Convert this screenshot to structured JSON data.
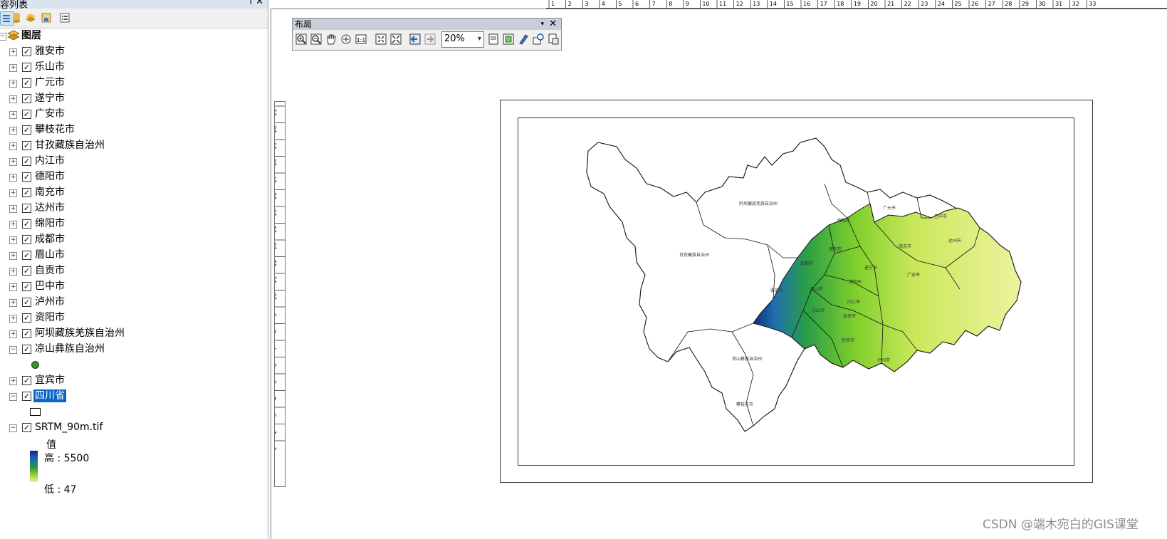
{
  "toc": {
    "title": "容列表",
    "root_label": "图层",
    "layers": [
      {
        "label": "雅安市"
      },
      {
        "label": "乐山市"
      },
      {
        "label": "广元市"
      },
      {
        "label": "遂宁市"
      },
      {
        "label": "广安市"
      },
      {
        "label": "攀枝花市"
      },
      {
        "label": "甘孜藏族自治州"
      },
      {
        "label": "内江市"
      },
      {
        "label": "德阳市"
      },
      {
        "label": "南充市"
      },
      {
        "label": "达州市"
      },
      {
        "label": "绵阳市"
      },
      {
        "label": "成都市"
      },
      {
        "label": "眉山市"
      },
      {
        "label": "自贡市"
      },
      {
        "label": "巴中市"
      },
      {
        "label": "泸州市"
      },
      {
        "label": "资阳市"
      },
      {
        "label": "阿坝藏族羌族自治州"
      },
      {
        "label": "凉山彝族自治州"
      },
      {
        "label": "宜宾市"
      },
      {
        "label": "四川省"
      },
      {
        "label": "SRTM_90m.tif"
      }
    ],
    "legend_value_label": "值",
    "legend_high": "高 : 5500",
    "legend_low": "低 : 47",
    "pin": "ꟾ",
    "close": "✕"
  },
  "layout_toolbar": {
    "title": "布局",
    "zoom_value": "20%",
    "dropdown_glyph": "▾",
    "close": "✕"
  },
  "ruler": {
    "h_ticks": [
      "1",
      "2",
      "3",
      "4",
      "5",
      "6",
      "7",
      "8",
      "9",
      "10",
      "11",
      "12",
      "13",
      "14",
      "15",
      "16",
      "17",
      "18",
      "19",
      "20",
      "21",
      "22",
      "23",
      "24",
      "25",
      "26",
      "27",
      "28",
      "29",
      "30",
      "31",
      "32",
      "33"
    ],
    "v_ticks": [
      "21",
      "20",
      "19",
      "18",
      "17",
      "16",
      "15",
      "14",
      "13",
      "12",
      "11",
      "10",
      "9",
      "8",
      "7",
      "6",
      "5",
      "4",
      "3",
      "2",
      "1"
    ]
  },
  "map_labels": {
    "aba": "阿坝藏族羌族自治州",
    "ganzi": "甘孜藏族自治州",
    "liangshan": "凉山彝族自治州",
    "panzhihua": "攀枝花市",
    "guangyuan": "广元市",
    "bazhong": "巴中市",
    "mianyang": "绵阳市",
    "dazhou": "达州市",
    "nanchong": "南充市",
    "deyang": "德阳市",
    "chengdu": "成都市",
    "suining": "遂宁市",
    "guangan": "广安市",
    "ziyang": "资阳市",
    "yaan": "雅安市",
    "meishan": "眉山市",
    "neijiang": "内江市",
    "leshan": "乐山市",
    "zigong": "自贡市",
    "yibin": "宜宾市",
    "luzhou": "泸州市"
  },
  "colors": {
    "ramp_high": "#1a237e",
    "ramp_mid": "#46b01e",
    "ramp_low": "#f3f08c",
    "selection": "#0a64c8"
  },
  "watermark": "CSDN @端木宛白的GIS课堂"
}
